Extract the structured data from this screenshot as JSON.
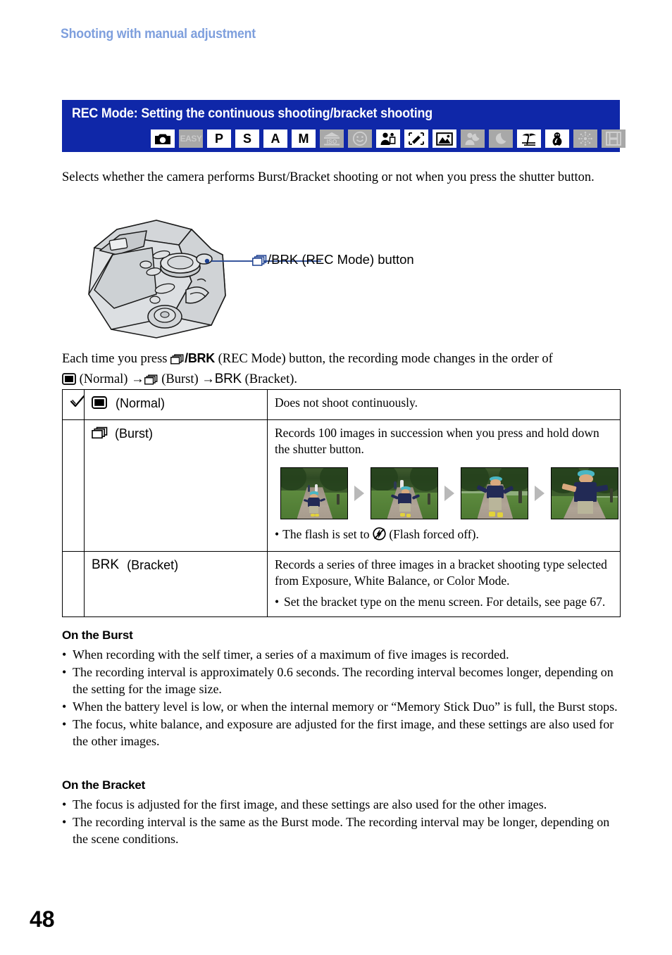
{
  "running_head": "Shooting with manual adjustment",
  "section": {
    "title": "REC Mode: Setting the continuous shooting/bracket shooting",
    "bg_color": "#0f27a8",
    "mode_icons": [
      {
        "name": "auto-adjustment-icon",
        "label": "",
        "icon": "camera",
        "enabled": true
      },
      {
        "name": "easy-shooting-icon",
        "label": "EASY",
        "icon": "text",
        "enabled": false
      },
      {
        "name": "program-auto-icon",
        "label": "P",
        "icon": "text",
        "enabled": true
      },
      {
        "name": "shutter-priority-icon",
        "label": "S",
        "icon": "text",
        "enabled": true
      },
      {
        "name": "aperture-priority-icon",
        "label": "A",
        "icon": "text",
        "enabled": true
      },
      {
        "name": "manual-exposure-icon",
        "label": "M",
        "icon": "text",
        "enabled": true
      },
      {
        "name": "high-sensitivity-iso-icon",
        "label": "ISO",
        "icon": "iso",
        "enabled": false
      },
      {
        "name": "smile-shutter-icon",
        "label": "",
        "icon": "smile",
        "enabled": false
      },
      {
        "name": "soft-snap-icon",
        "label": "",
        "icon": "soft-snap",
        "enabled": true
      },
      {
        "name": "high-speed-shutter-icon",
        "label": "",
        "icon": "high-speed",
        "enabled": true
      },
      {
        "name": "landscape-icon",
        "label": "",
        "icon": "landscape",
        "enabled": true
      },
      {
        "name": "twilight-portrait-icon",
        "label": "",
        "icon": "twilight-portrait",
        "enabled": false
      },
      {
        "name": "twilight-icon",
        "label": "",
        "icon": "moon",
        "enabled": false
      },
      {
        "name": "beach-icon",
        "label": "",
        "icon": "beach",
        "enabled": true
      },
      {
        "name": "snow-icon",
        "label": "",
        "icon": "snowman",
        "enabled": true
      },
      {
        "name": "fireworks-icon",
        "label": "",
        "icon": "fireworks",
        "enabled": false
      },
      {
        "name": "movie-mode-icon",
        "label": "",
        "icon": "film",
        "enabled": false
      }
    ]
  },
  "intro_paragraph": "Selects whether the camera performs Burst/Bracket shooting or not when you press the shutter button.",
  "figure": {
    "callout_prefix": "",
    "callout_text": "/BRK (REC Mode) button"
  },
  "order_paragraph": {
    "line1_a": "Each time you press ",
    "line1_b": "/BRK",
    "line1_c": " (REC Mode) button, the recording mode changes in the order of",
    "line2_a": " (Normal) ",
    "line2_arrow1": "→",
    "line2_b": " (Burst) ",
    "line2_arrow2": "→",
    "line2_c": "BRK",
    "line2_d": " (Bracket)."
  },
  "table": {
    "rows": [
      {
        "checked": true,
        "check_glyph": "✓",
        "mode_icon": "normal-square-icon",
        "mode_label": "(Normal)",
        "mode_prefix": "",
        "description": "Does not shoot continuously.",
        "has_photos": false,
        "note": ""
      },
      {
        "checked": false,
        "check_glyph": "",
        "mode_icon": "burst-stack-icon",
        "mode_label": "(Burst)",
        "mode_prefix": "",
        "description": "Records 100 images in succession when you press and hold down the shutter button.",
        "has_photos": true,
        "photo_count": 4,
        "photo_alt": "Sequence of a child running toward the camera on a park path",
        "note_bullet": "•",
        "note_before": "The flash is set to ",
        "note_icon": "flash-off-icon",
        "note_after": " (Flash forced off)."
      },
      {
        "checked": false,
        "check_glyph": "",
        "mode_icon": "bracket-text-icon",
        "mode_label": "(Bracket)",
        "mode_prefix": "BRK",
        "description": "Records a series of three images in a bracket shooting type selected from Exposure, White Balance, or Color Mode.",
        "has_photos": false,
        "note_bullet": "•",
        "note": "Set the bracket type on the menu screen. For details, see page 67."
      }
    ]
  },
  "burst_section": {
    "heading": "On the Burst",
    "bullets": [
      "When recording with the self timer, a series of a maximum of five images is recorded.",
      "The recording interval is approximately 0.6 seconds. The recording interval becomes longer, depending on the setting for the image size.",
      "When the battery level is low, or when the internal memory or “Memory Stick Duo” is full, the Burst stops.",
      "The focus, white balance, and exposure are adjusted for the first image, and these settings are also used for the other images."
    ],
    "bullet_glyph": "•"
  },
  "bracket_section": {
    "heading": "On the Bracket",
    "bullets": [
      "The focus is adjusted for the first image, and these settings are also used for the other images.",
      "The recording interval is the same as the Burst mode. The recording interval may be longer, depending on the scene conditions."
    ],
    "bullet_glyph": "•"
  },
  "page_number": "48"
}
